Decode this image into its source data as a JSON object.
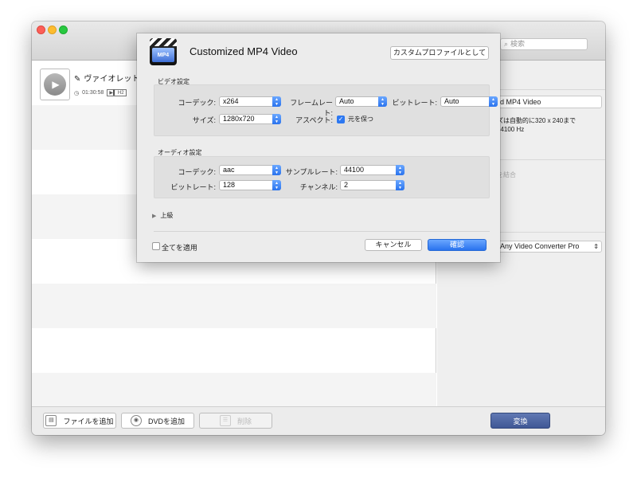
{
  "window": {
    "search_placeholder": "検索"
  },
  "file_item": {
    "name": "ヴァイオレット",
    "duration": "01:30:58",
    "codec": "H2"
  },
  "right_panel": {
    "profile_name": "d MP4 Video",
    "info_line1": "ズは自動的に320 x 240まで",
    "info_line2": "44100 Hz",
    "merge_label": "を結合",
    "output_folder": "Any Video Converter Pro"
  },
  "bottom_bar": {
    "add_file_label": "ファイルを追加",
    "add_dvd_label": "DVDを追加",
    "delete_label": "削除",
    "convert_label": "変換"
  },
  "dialog": {
    "icon_text": "MP4",
    "title": "Customized MP4 Video",
    "custom_profile_button": "カスタムプロファイルとして",
    "video_section": "ビデオ設定",
    "video": {
      "codec_label": "コーデック:",
      "codec_value": "x264",
      "framerate_label": "フレームレート:",
      "framerate_value": "Auto",
      "bitrate_label": "ビットレート:",
      "bitrate_value": "Auto",
      "size_label": "サイズ:",
      "size_value": "1280x720",
      "aspect_label": "アスペクト:",
      "keep_original_label": "元を保つ"
    },
    "audio_section": "オーディオ設定",
    "audio": {
      "codec_label": "コーデック:",
      "codec_value": "aac",
      "samplerate_label": "サンプルレート:",
      "samplerate_value": "44100",
      "bitrate_label": "ビットレート:",
      "bitrate_value": "128",
      "channels_label": "チャンネル:",
      "channels_value": "2"
    },
    "advanced_label": "上級",
    "apply_all_label": "全てを適用",
    "cancel_label": "キャンセル",
    "ok_label": "確認"
  }
}
